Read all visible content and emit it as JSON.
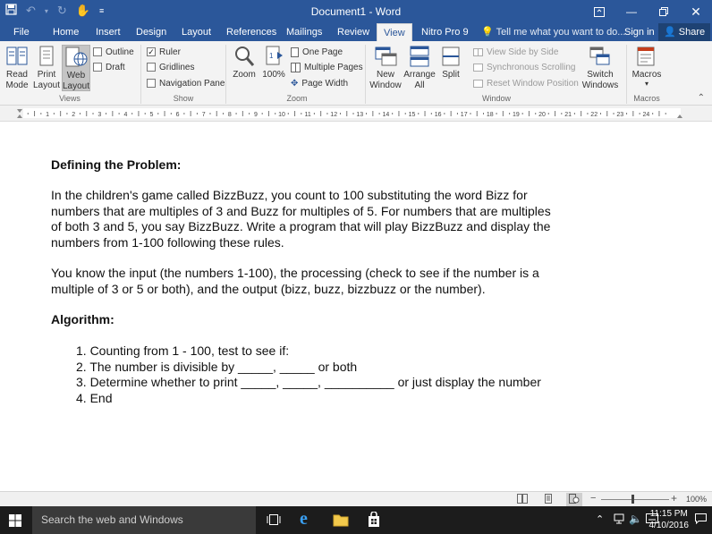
{
  "window": {
    "title": "Document1 - Word",
    "buttons": [
      "ribbon-display",
      "minimize",
      "restore",
      "close"
    ]
  },
  "quick_access": {
    "save": "save-icon",
    "undo": "undo-icon",
    "redo": "redo-icon",
    "touch": "touch-mode-icon",
    "customize": "customize-qat-icon"
  },
  "tabs": [
    {
      "label": "File"
    },
    {
      "label": "Home"
    },
    {
      "label": "Insert"
    },
    {
      "label": "Design"
    },
    {
      "label": "Layout"
    },
    {
      "label": "References"
    },
    {
      "label": "Mailings"
    },
    {
      "label": "Review"
    },
    {
      "label": "View",
      "active": true
    },
    {
      "label": "Nitro Pro 9"
    }
  ],
  "tell_me": "Tell me what you want to do...",
  "sign_in": "Sign in",
  "share": "Share",
  "ribbon": {
    "views": {
      "label": "Views",
      "read_mode": "Read Mode",
      "print_layout": "Print Layout",
      "web_layout": "Web Layout",
      "outline": "Outline",
      "draft": "Draft"
    },
    "show": {
      "label": "Show",
      "ruler": "Ruler",
      "ruler_checked": true,
      "gridlines": "Gridlines",
      "gridlines_checked": false,
      "navigation_pane": "Navigation Pane",
      "navigation_pane_checked": false
    },
    "zoom": {
      "label": "Zoom",
      "zoom": "Zoom",
      "hundred": "100%",
      "one_page": "One Page",
      "multiple_pages": "Multiple Pages",
      "page_width": "Page Width"
    },
    "window": {
      "label": "Window",
      "new_window": "New Window",
      "arrange_all": "Arrange All",
      "split": "Split",
      "view_side_by_side": "View Side by Side",
      "synchronous_scrolling": "Synchronous Scrolling",
      "reset_window_position": "Reset Window Position",
      "switch_windows": "Switch Windows"
    },
    "macros": {
      "label": "Macros",
      "macros": "Macros"
    }
  },
  "ruler_numbers": [
    "1",
    "2",
    "3",
    "4",
    "5",
    "6",
    "7",
    "8",
    "9",
    "10",
    "11",
    "12",
    "13",
    "14",
    "15",
    "16",
    "17",
    "18",
    "19",
    "20",
    "21",
    "22",
    "23",
    "24"
  ],
  "document": {
    "heading1": "Defining the Problem:",
    "para1_lines": [
      "In the children's game called BizzBuzz, you count to 100 substituting the word Bizz for",
      "numbers that are multiples of 3 and Buzz for multiples of 5. For numbers that are multiples",
      "of both 3 and 5, you say BizzBuzz. Write a program that will play BizzBuzz and display the",
      "numbers from 1-100 following these rules."
    ],
    "para2_lines": [
      "You know the input (the numbers 1-100), the processing (check to see if the number is a",
      "multiple of 3 or 5 or both), and the output (bizz, buzz, bizzbuzz or the number)."
    ],
    "heading2": "Algorithm:",
    "steps": [
      "1. Counting from 1 - 100, test to see if:",
      "2. The number is divisible by _____, _____ or both",
      "3. Determine whether to print _____, _____, __________ or just display the number",
      "4. End"
    ]
  },
  "status": {
    "zoom_percent": "100%",
    "zoom_fraction": 0.5
  },
  "taskbar": {
    "search_placeholder": "Search the web and Windows",
    "time": "11:15 PM",
    "date": "4/10/2016"
  },
  "colors": {
    "word_blue": "#2b579a",
    "ribbon_bg": "#f3f3f3",
    "taskbar_bg": "#1c1c1c"
  }
}
